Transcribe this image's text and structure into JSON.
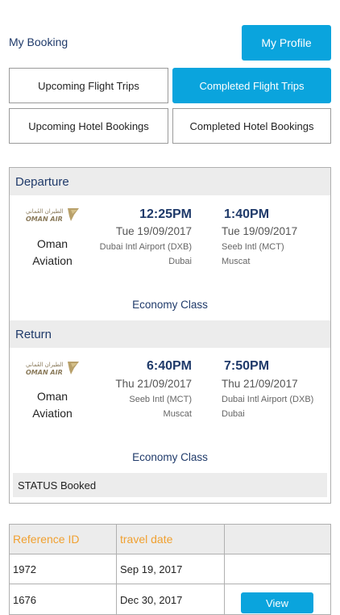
{
  "header": {
    "title": "My Booking",
    "profile_button": "My Profile"
  },
  "tabs": [
    {
      "label": "Upcoming Flight Trips",
      "active": false
    },
    {
      "label": "Completed Flight Trips",
      "active": true
    },
    {
      "label": "Upcoming Hotel Bookings",
      "active": false
    },
    {
      "label": "Completed Hotel Bookings",
      "active": false
    }
  ],
  "booking": {
    "departure": {
      "heading": "Departure",
      "airline_logo": "OMAN AIR",
      "airline_logo_ar": "الطيران العُماني",
      "airline_line1": "Oman",
      "airline_line2": "Aviation",
      "dep_time": "12:25PM",
      "dep_date": "Tue 19/09/2017",
      "dep_airport": "Dubai Intl Airport (DXB)",
      "dep_city": "Dubai",
      "arr_time": "1:40PM",
      "arr_date": "Tue 19/09/2017",
      "arr_airport": "Seeb Intl (MCT)",
      "arr_city": "Muscat",
      "class": "Economy Class"
    },
    "return": {
      "heading": "Return",
      "airline_logo": "OMAN AIR",
      "airline_logo_ar": "الطيران العُماني",
      "airline_line1": "Oman",
      "airline_line2": "Aviation",
      "dep_time": "6:40PM",
      "dep_date": "Thu 21/09/2017",
      "dep_airport": "Seeb Intl (MCT)",
      "dep_city": "Muscat",
      "arr_time": "7:50PM",
      "arr_date": "Thu 21/09/2017",
      "arr_airport": "Dubai Intl Airport (DXB)",
      "arr_city": "Dubai",
      "class": "Economy Class"
    },
    "status": "STATUS  Booked"
  },
  "table": {
    "headers": [
      "Reference ID",
      "travel date",
      ""
    ],
    "rows": [
      {
        "ref": "1972",
        "date": "Sep 19, 2017",
        "action": ""
      },
      {
        "ref": "1676",
        "date": "Dec 30, 2017",
        "action": "View"
      }
    ]
  },
  "colors": {
    "accent": "#0aa4dd",
    "navy": "#1f3a6a",
    "header_orange": "#f0a030",
    "section_bg": "#ececec"
  }
}
